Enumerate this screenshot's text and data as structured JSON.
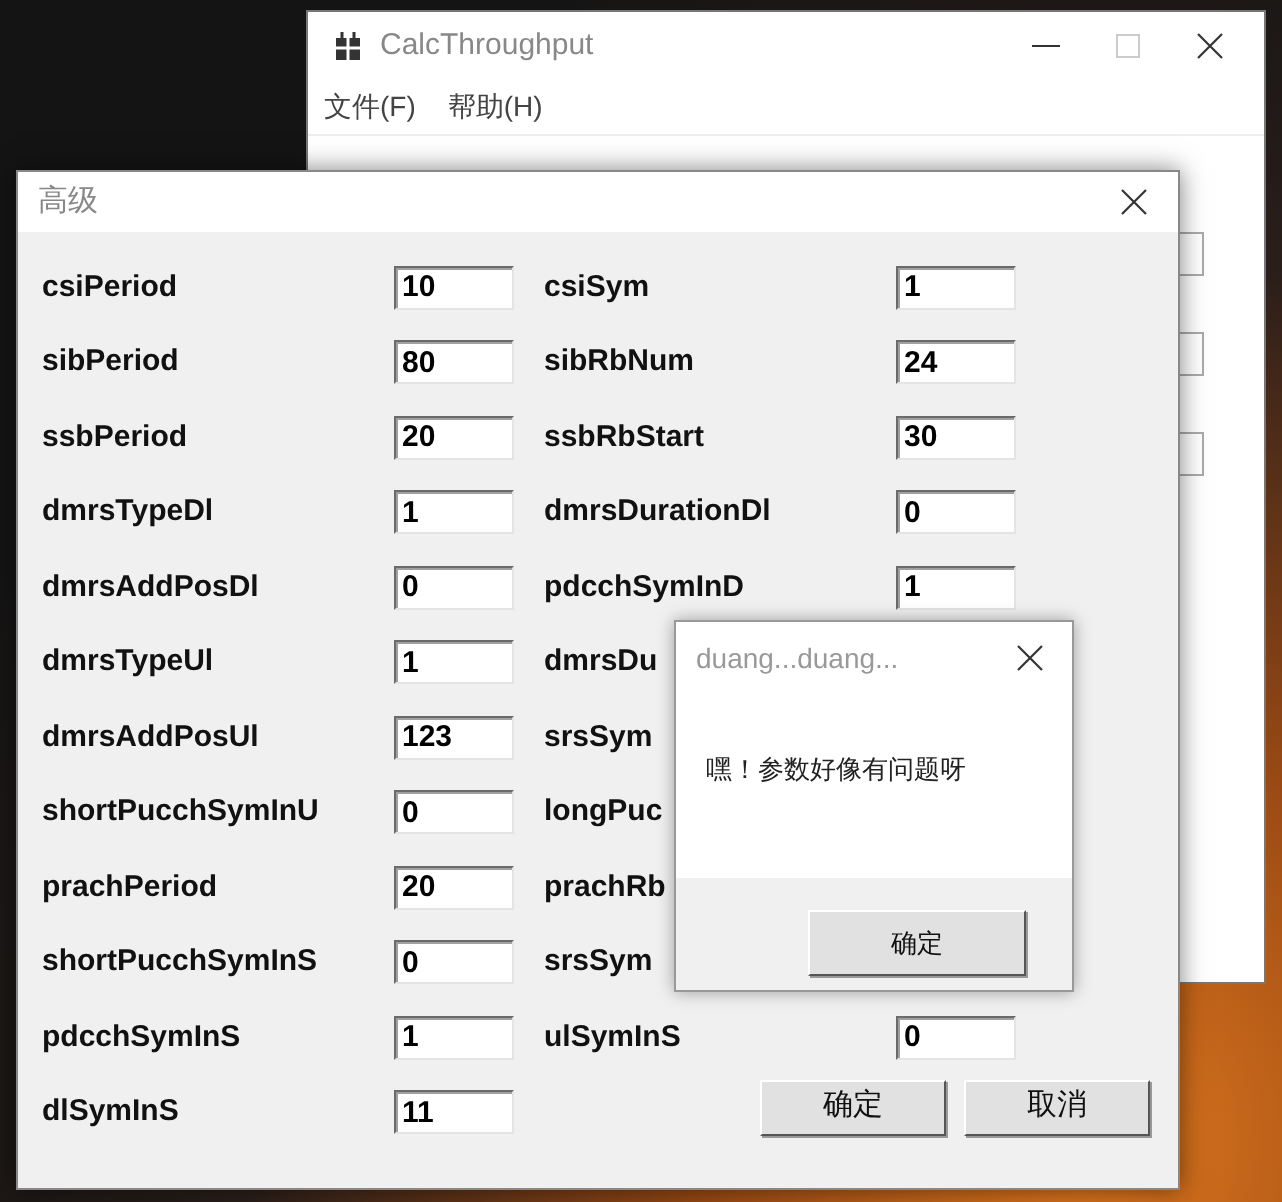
{
  "main_window": {
    "title": "CalcThroughput",
    "menu": [
      "文件(F)",
      "帮助(H)"
    ]
  },
  "advanced_dialog": {
    "title": "高级",
    "left_fields": [
      {
        "label": "csiPeriod",
        "value": "10"
      },
      {
        "label": "sibPeriod",
        "value": "80"
      },
      {
        "label": "ssbPeriod",
        "value": "20"
      },
      {
        "label": "dmrsTypeDl",
        "value": "1"
      },
      {
        "label": "dmrsAddPosDl",
        "value": "0"
      },
      {
        "label": "dmrsTypeUl",
        "value": "1"
      },
      {
        "label": "dmrsAddPosUl",
        "value": "123"
      },
      {
        "label": "shortPucchSymInU",
        "value": "0"
      },
      {
        "label": "prachPeriod",
        "value": "20"
      },
      {
        "label": "shortPucchSymInS",
        "value": "0"
      },
      {
        "label": "pdcchSymInS",
        "value": "1"
      },
      {
        "label": "dlSymInS",
        "value": "11"
      }
    ],
    "right_fields": [
      {
        "label": "csiSym",
        "value": "1"
      },
      {
        "label": "sibRbNum",
        "value": "24"
      },
      {
        "label": "ssbRbStart",
        "value": "30"
      },
      {
        "label": "dmrsDurationDl",
        "value": "0"
      },
      {
        "label": "pdcchSymInD",
        "value": "1"
      },
      {
        "label": "dmrsDu"
      },
      {
        "label": "srsSym"
      },
      {
        "label": "longPuc"
      },
      {
        "label": "prachRb"
      },
      {
        "label": "srsSym"
      },
      {
        "label": "ulSymInS",
        "value": "0"
      }
    ],
    "buttons": [
      "确定",
      "取消"
    ]
  },
  "message_box": {
    "title": "duang...duang...",
    "message": "嘿！参数好像有问题呀",
    "button": "确定"
  }
}
